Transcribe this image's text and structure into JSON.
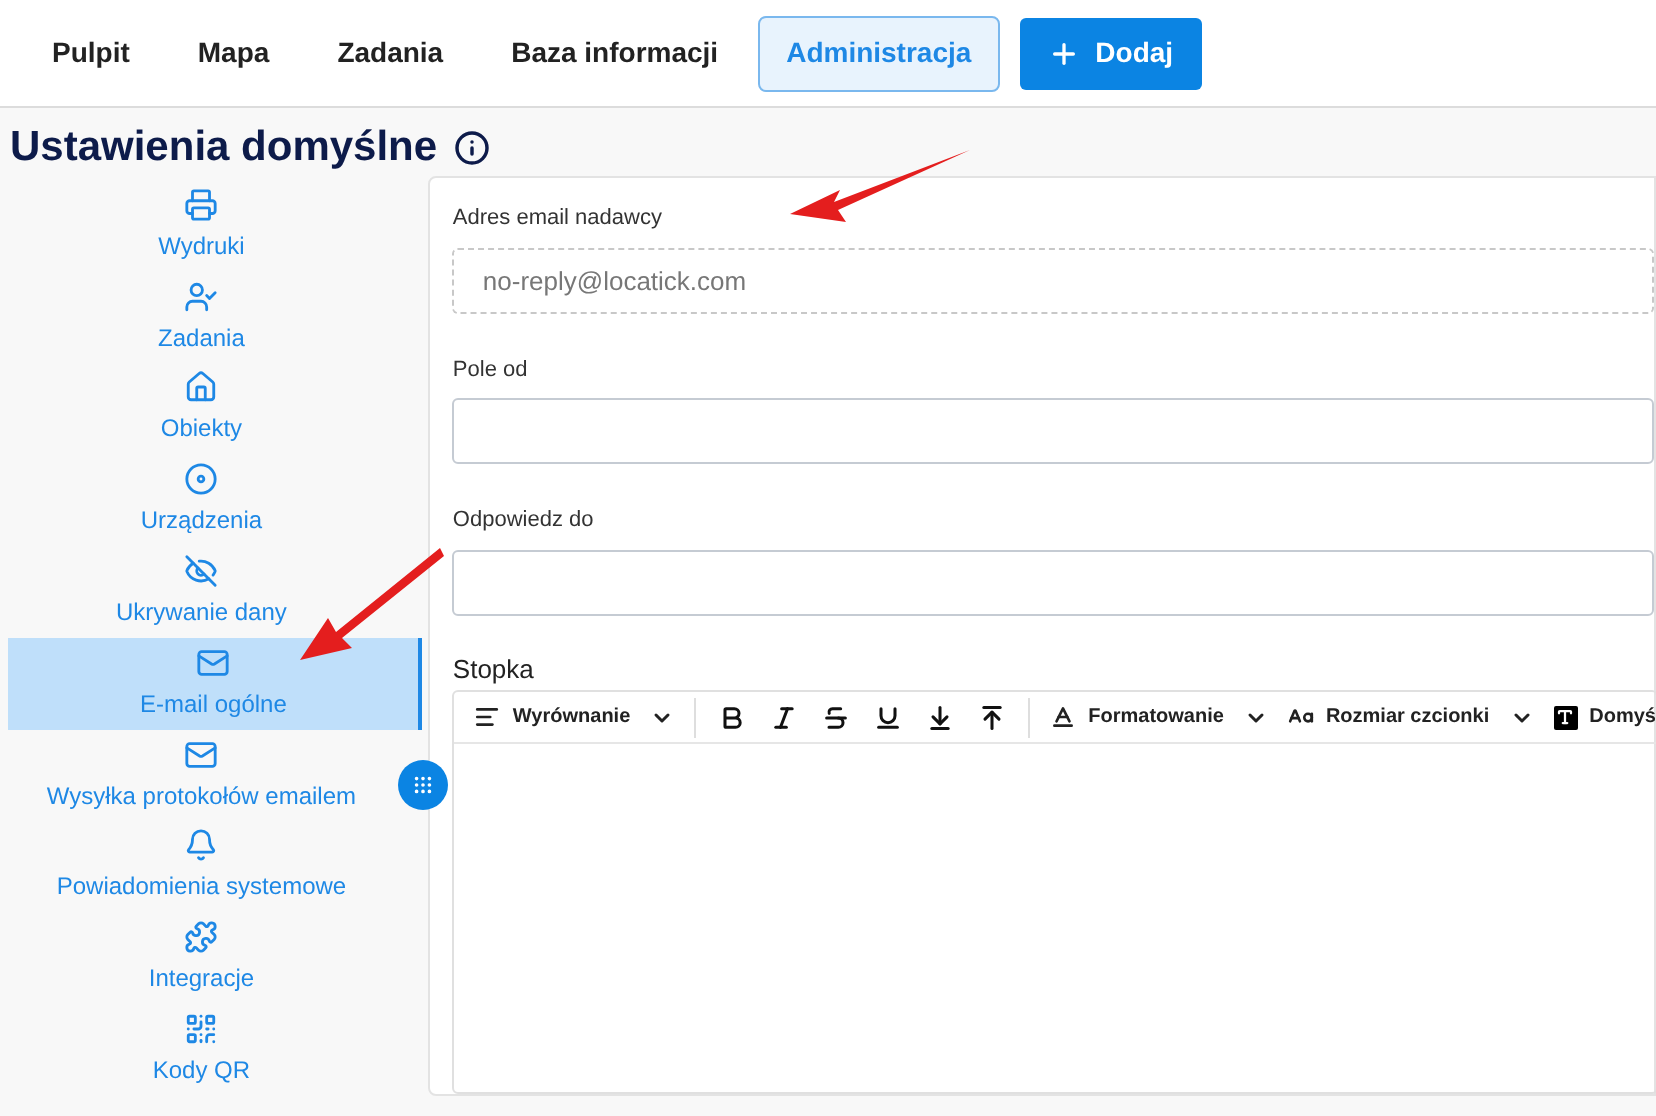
{
  "nav": {
    "items": [
      {
        "label": "Pulpit",
        "selected": false
      },
      {
        "label": "Mapa",
        "selected": false
      },
      {
        "label": "Zadania",
        "selected": false
      },
      {
        "label": "Baza informacji",
        "selected": false
      },
      {
        "label": "Administracja",
        "selected": true
      }
    ],
    "add_button": {
      "label": "Dodaj"
    }
  },
  "title": "Ustawienia domyślne",
  "sidebar": {
    "items": [
      {
        "label": "Wydruki",
        "selected": false
      },
      {
        "label": "Zadania",
        "selected": false
      },
      {
        "label": "Obiekty",
        "selected": false
      },
      {
        "label": "Urządzenia",
        "selected": false
      },
      {
        "label": "Ukrywanie dany",
        "selected": false
      },
      {
        "label": "E-mail ogólne",
        "selected": true
      },
      {
        "label": "Wysyłka protokołów emailem",
        "selected": false
      },
      {
        "label": "Powiadomienia systemowe",
        "selected": false
      },
      {
        "label": "Integracje",
        "selected": false
      },
      {
        "label": "Kody QR",
        "selected": false
      }
    ]
  },
  "form": {
    "fields": [
      {
        "label": "Adres email nadawcy",
        "value": "no-reply@locatick.com",
        "disabled": true
      },
      {
        "label": "Pole od",
        "disabled": false
      },
      {
        "label": "Odpowiedz do",
        "disabled": false
      }
    ],
    "footer_label": "Stopka",
    "toolbar": [
      {
        "kind": "dropdown",
        "label": "Wyrównanie"
      },
      {
        "kind": "separator"
      },
      {
        "kind": "icon"
      },
      {
        "kind": "icon"
      },
      {
        "kind": "icon"
      },
      {
        "kind": "icon"
      },
      {
        "kind": "icon"
      },
      {
        "kind": "icon"
      },
      {
        "kind": "separator"
      },
      {
        "kind": "dropdown",
        "label": "Formatowanie"
      },
      {
        "kind": "dropdown",
        "label": "Rozmiar czcionki"
      },
      {
        "kind": "dropdown",
        "label": "Domyś"
      }
    ]
  }
}
